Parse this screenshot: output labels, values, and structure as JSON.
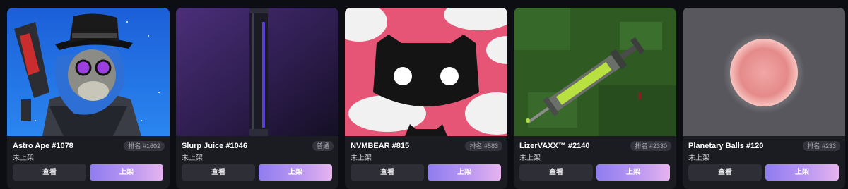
{
  "cards": [
    {
      "title": "Astro Ape #1078",
      "badge": "排名 #1602",
      "status": "未上架",
      "view_label": "查看",
      "list_label": "上架",
      "art": "astronaut-ape-icon"
    },
    {
      "title": "Slurp Juice #1046",
      "badge": "普通",
      "status": "未上架",
      "view_label": "查看",
      "list_label": "上架",
      "art": "juice-vial-icon"
    },
    {
      "title": "NVMBEAR #815",
      "badge": "排名 #583",
      "status": "未上架",
      "view_label": "查看",
      "list_label": "上架",
      "art": "bear-face-icon"
    },
    {
      "title": "LizerVAXX™ #2140",
      "badge": "排名 #2330",
      "status": "未上架",
      "view_label": "查看",
      "list_label": "上架",
      "art": "syringe-icon"
    },
    {
      "title": "Planetary Balls #120",
      "badge": "排名 #233",
      "status": "未上架",
      "view_label": "查看",
      "list_label": "上架",
      "art": "pink-planet-icon"
    }
  ],
  "colors": {
    "background": "#0d0e13",
    "card": "#1b1c22",
    "button_view": "#2e2f36",
    "button_list_gradient": [
      "#8f7cf0",
      "#b997f2",
      "#e6b3ee"
    ]
  }
}
